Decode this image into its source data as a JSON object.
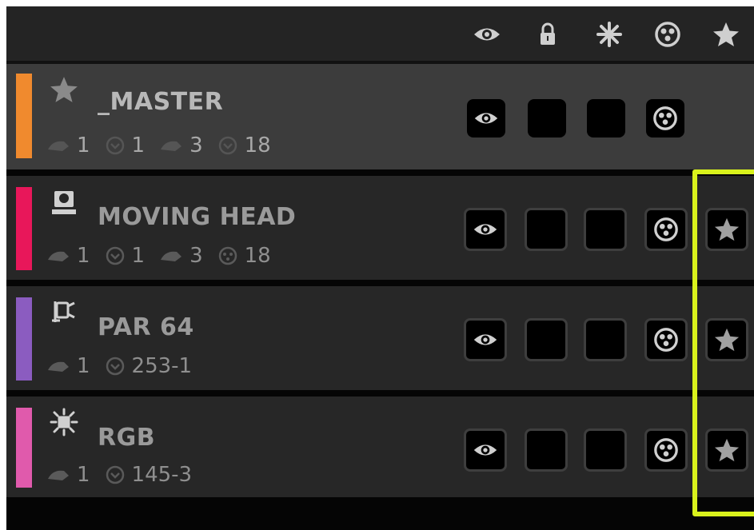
{
  "header": {
    "icons": [
      "eye-icon",
      "lock-icon",
      "asterisk-icon",
      "gobo-icon",
      "star-icon"
    ]
  },
  "colors": {
    "master": "#f08a2e",
    "moving_head": "#e8175a",
    "par_64": "#8b5cc0",
    "rgb": "#e05aac",
    "highlight": "#d9f21c"
  },
  "rows": [
    {
      "name": "_MASTER",
      "icon": "star-icon",
      "stats": [
        "1",
        "1",
        "3",
        "18"
      ]
    },
    {
      "name": "MOVING HEAD",
      "icon": "moving-head-icon",
      "stats": [
        "1",
        "1",
        "3",
        "18"
      ]
    },
    {
      "name": "PAR 64",
      "icon": "par-can-icon",
      "stats": [
        "1",
        "253-1"
      ]
    },
    {
      "name": "RGB",
      "icon": "rgb-light-icon",
      "stats": [
        "1",
        "145-3"
      ]
    }
  ]
}
